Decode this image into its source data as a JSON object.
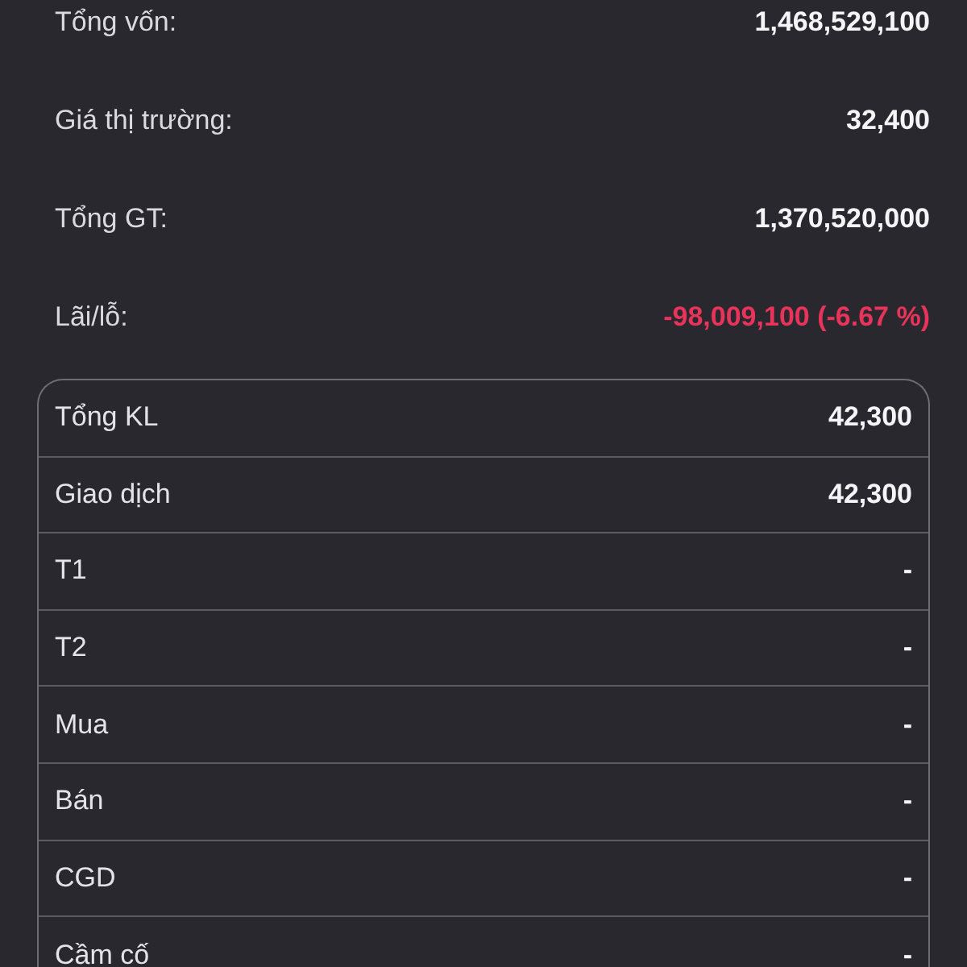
{
  "summary": [
    {
      "label": "Tổng vốn:",
      "value": "1,468,529,100",
      "color": "#f5f5f7"
    },
    {
      "label": "Giá thị trường:",
      "value": "32,400",
      "color": "#f5f5f7"
    },
    {
      "label": "Tổng GT:",
      "value": "1,370,520,000",
      "color": "#f5f5f7"
    },
    {
      "label": "Lãi/lỗ:",
      "value": "-98,009,100 (-6.67 %)",
      "color": "#e8335b"
    }
  ],
  "details_table": {
    "rows": [
      {
        "label": "Tổng KL",
        "value": "42,300"
      },
      {
        "label": "Giao dịch",
        "value": "42,300"
      },
      {
        "label": "T1",
        "value": "-"
      },
      {
        "label": "T2",
        "value": "-"
      },
      {
        "label": "Mua",
        "value": "-"
      },
      {
        "label": "Bán",
        "value": "-"
      },
      {
        "label": "CGD",
        "value": "-"
      },
      {
        "label": "Cầm cố",
        "value": "-"
      }
    ]
  }
}
